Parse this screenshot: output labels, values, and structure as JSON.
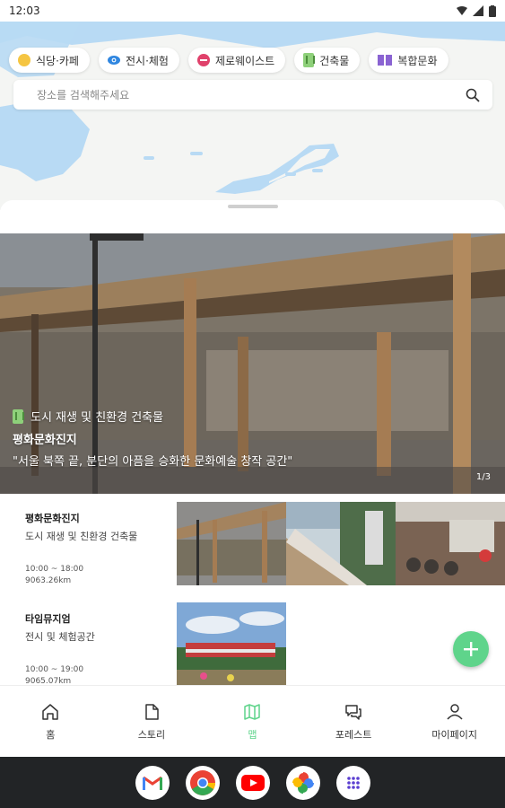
{
  "status": {
    "time": "12:03"
  },
  "chips": [
    {
      "label": "식당·카페",
      "icon": "cafe-icon",
      "color": "#f5c542"
    },
    {
      "label": "전시·체험",
      "icon": "eye-icon",
      "color": "#2f86e0"
    },
    {
      "label": "제로웨이스트",
      "icon": "no-entry-icon",
      "color": "#e0416b"
    },
    {
      "label": "건축물",
      "icon": "building-icon",
      "color": "#8ed07a"
    },
    {
      "label": "복합문화",
      "icon": "book-icon",
      "color": "#8a63d2"
    }
  ],
  "search": {
    "placeholder": "장소를 검색해주세요"
  },
  "hero": {
    "category": "도시 재생 및 친환경 건축물",
    "title": "평화문화진지",
    "description": "\"서울 북쪽 끝, 분단의 아픔을 승화한 문화예술 창작 공간\"",
    "page": "1/3"
  },
  "places": [
    {
      "name": "평화문화진지",
      "category": "도시 재생 및 친환경 건축물",
      "hours": "10:00 ~ 18:00",
      "distance": "9063.26km"
    },
    {
      "name": "타임뮤지엄",
      "category": "전시 및 체험공간",
      "hours": "10:00 ~ 19:00",
      "distance": "9065.07km"
    }
  ],
  "nav": [
    {
      "label": "홈",
      "icon": "home-icon"
    },
    {
      "label": "스토리",
      "icon": "document-icon"
    },
    {
      "label": "맵",
      "icon": "map-icon"
    },
    {
      "label": "포레스트",
      "icon": "chat-icon"
    },
    {
      "label": "마이페이지",
      "icon": "person-icon"
    }
  ],
  "system_apps": [
    "gmail-icon",
    "chrome-icon",
    "youtube-icon",
    "photos-icon",
    "apps-icon"
  ],
  "colors": {
    "accent": "#5fd48b",
    "water": "#b8daf4"
  }
}
